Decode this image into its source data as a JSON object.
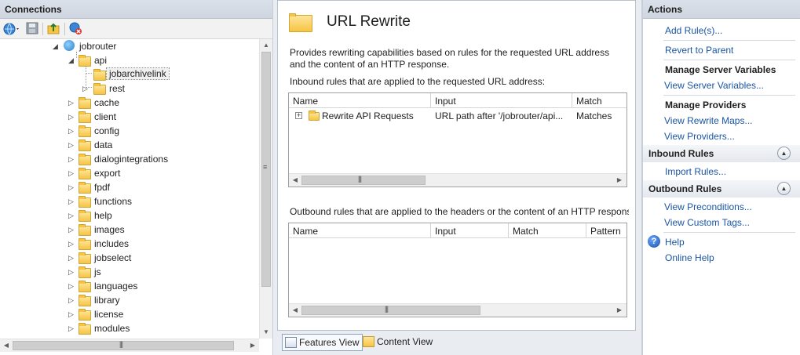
{
  "connections": {
    "title": "Connections",
    "tree": [
      {
        "label": "jobrouter",
        "level": 0,
        "expanded": true,
        "icon": "site-icon"
      },
      {
        "label": "api",
        "level": 1,
        "expanded": true,
        "icon": "folder-icon"
      },
      {
        "label": "jobarchivelink",
        "level": 2,
        "selected": true,
        "icon": "folder-icon"
      },
      {
        "label": "rest",
        "level": 2,
        "icon": "folder-icon"
      },
      {
        "label": "cache",
        "level": 1,
        "icon": "folder-icon"
      },
      {
        "label": "client",
        "level": 1,
        "icon": "folder-icon"
      },
      {
        "label": "config",
        "level": 1,
        "icon": "folder-icon"
      },
      {
        "label": "data",
        "level": 1,
        "icon": "folder-icon"
      },
      {
        "label": "dialogintegrations",
        "level": 1,
        "icon": "folder-icon"
      },
      {
        "label": "export",
        "level": 1,
        "icon": "folder-icon"
      },
      {
        "label": "fpdf",
        "level": 1,
        "icon": "folder-icon"
      },
      {
        "label": "functions",
        "level": 1,
        "icon": "folder-icon"
      },
      {
        "label": "help",
        "level": 1,
        "icon": "folder-icon"
      },
      {
        "label": "images",
        "level": 1,
        "icon": "folder-icon"
      },
      {
        "label": "includes",
        "level": 1,
        "icon": "folder-icon"
      },
      {
        "label": "jobselect",
        "level": 1,
        "icon": "folder-icon"
      },
      {
        "label": "js",
        "level": 1,
        "icon": "folder-icon"
      },
      {
        "label": "languages",
        "level": 1,
        "icon": "folder-icon"
      },
      {
        "label": "library",
        "level": 1,
        "icon": "folder-icon"
      },
      {
        "label": "license",
        "level": 1,
        "icon": "folder-icon"
      },
      {
        "label": "modules",
        "level": 1,
        "icon": "folder-icon"
      }
    ]
  },
  "feature": {
    "title": "URL Rewrite",
    "description": "Provides rewriting capabilities based on rules for the requested URL address and the content of an HTTP response.",
    "inbound_label": "Inbound rules that are applied to the requested URL address:",
    "inbound_columns": [
      "Name",
      "Input",
      "Match"
    ],
    "inbound_rows": [
      {
        "name": "Rewrite API Requests",
        "input": "URL path after '/jobrouter/api...",
        "match": "Matches"
      }
    ],
    "outbound_label": "Outbound rules that are applied to the headers or the content of an HTTP response",
    "outbound_columns": [
      "Name",
      "Input",
      "Match",
      "Pattern"
    ]
  },
  "viewbar": {
    "features_view": "Features View",
    "content_view": "Content View"
  },
  "actions": {
    "title": "Actions",
    "add_rules": "Add Rule(s)...",
    "revert_to_parent": "Revert to Parent",
    "manage_server_variables": "Manage Server Variables",
    "view_server_variables": "View Server Variables...",
    "manage_providers": "Manage Providers",
    "view_rewrite_maps": "View Rewrite Maps...",
    "view_providers": "View Providers...",
    "inbound_rules": "Inbound Rules",
    "import_rules": "Import Rules...",
    "outbound_rules": "Outbound Rules",
    "view_preconditions": "View Preconditions...",
    "view_custom_tags": "View Custom Tags...",
    "help": "Help",
    "online_help": "Online Help"
  }
}
